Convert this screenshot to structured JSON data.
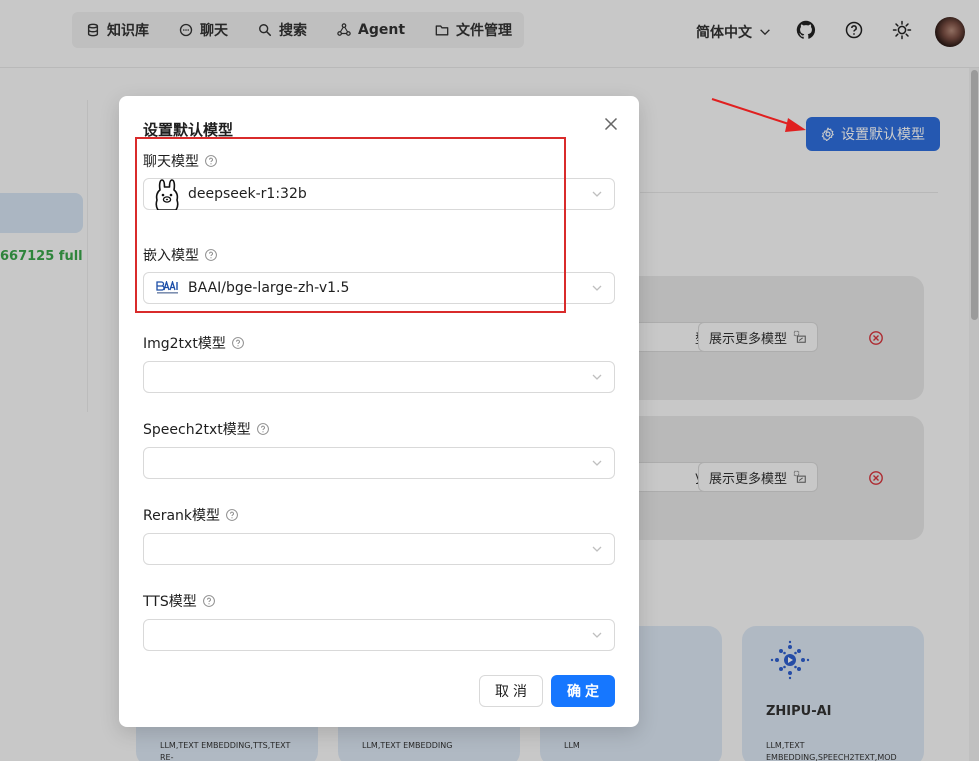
{
  "header": {
    "nav": [
      {
        "label": "知识库",
        "icon": "database-icon"
      },
      {
        "label": "聊天",
        "icon": "chat-icon"
      },
      {
        "label": "搜索",
        "icon": "search-icon"
      },
      {
        "label": "Agent",
        "icon": "agent-graph-icon"
      },
      {
        "label": "文件管理",
        "icon": "folder-icon"
      }
    ],
    "language": "简体中文"
  },
  "background": {
    "side_text": "667125 full",
    "default_model_button": "设置默认模型",
    "cards": [
      {
        "chip_left": "型",
        "chip_right": "展示更多模型"
      },
      {
        "chip_left": "y",
        "chip_right": "展示更多模型"
      }
    ],
    "provider_cards": [
      {
        "tags": "LLM,TEXT EMBEDDING,TTS,TEXT RE-"
      },
      {
        "tags": "LLM,TEXT EMBEDDING"
      },
      {
        "tags": "LLM"
      },
      {
        "name": "ZHIPU-AI",
        "tags": "LLM,TEXT EMBEDDING,SPEECH2TEXT,MOD"
      }
    ]
  },
  "modal": {
    "title": "设置默认模型",
    "fields": [
      {
        "label": "聊天模型",
        "value": "deepseek-r1:32b",
        "logo": "ollama-llama-icon"
      },
      {
        "label": "嵌入模型",
        "value": "BAAI/bge-large-zh-v1.5",
        "logo": "baai-logo"
      },
      {
        "label": "Img2txt模型",
        "value": ""
      },
      {
        "label": "Speech2txt模型",
        "value": ""
      },
      {
        "label": "Rerank模型",
        "value": ""
      },
      {
        "label": "TTS模型",
        "value": ""
      }
    ],
    "cancel_label": "取消",
    "ok_label": "确定"
  },
  "colors": {
    "primary": "#1677ff",
    "default_button": "#2f6fde",
    "highlight_red": "#d92b2b",
    "status_green": "#3aa64a",
    "delete_red": "#d9363e"
  }
}
